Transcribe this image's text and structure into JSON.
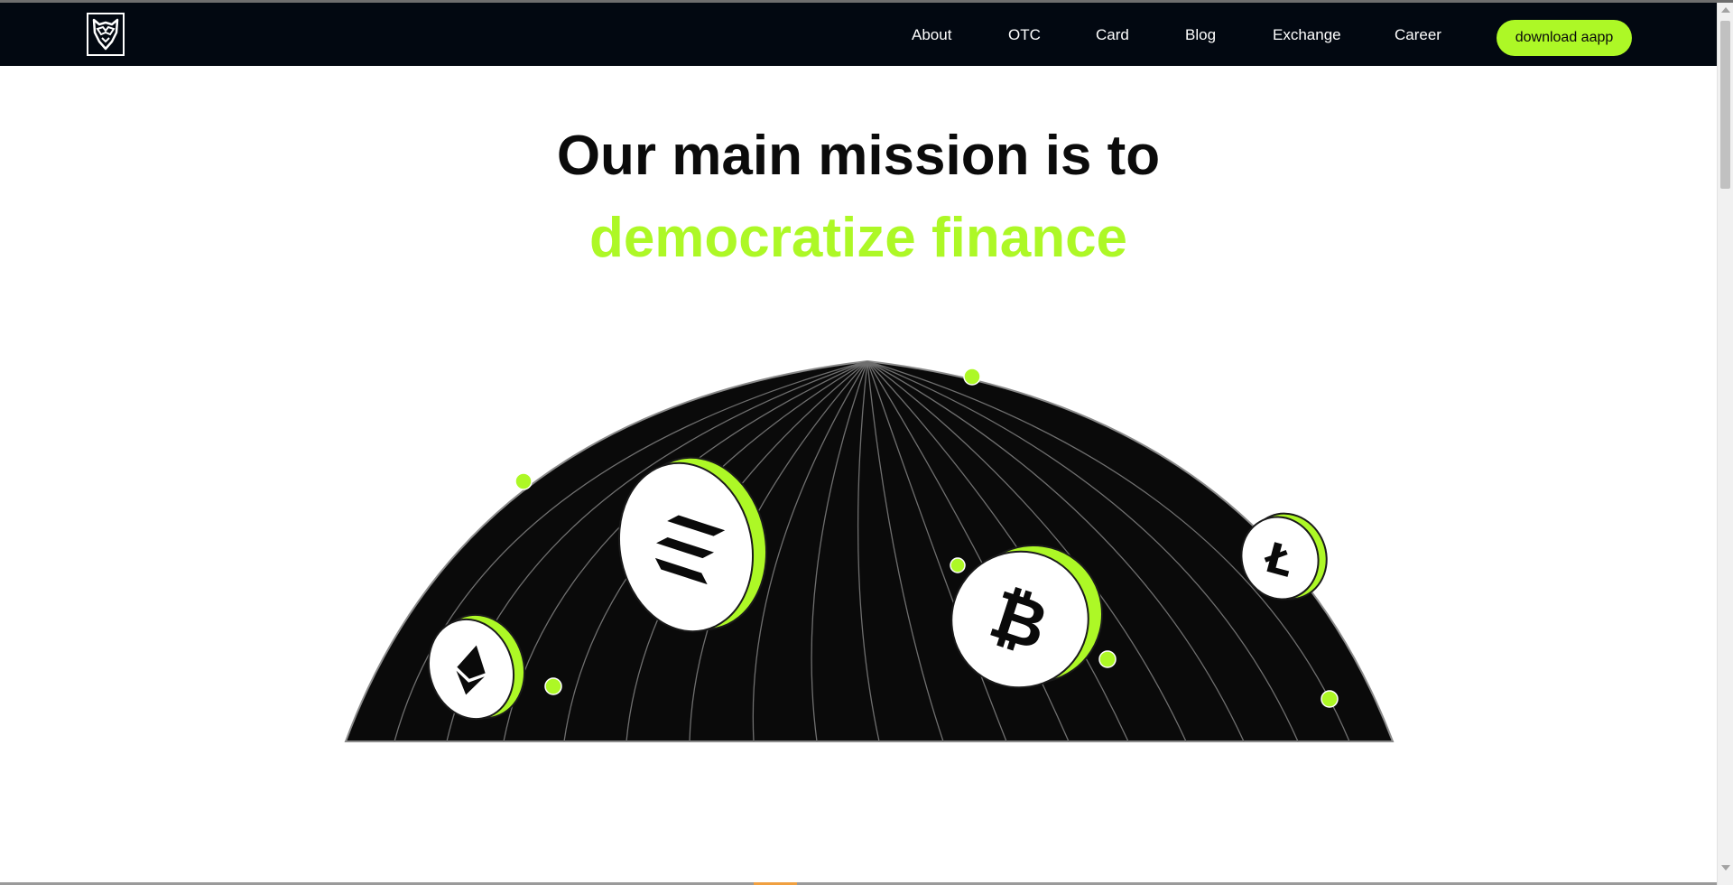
{
  "header": {
    "logo_icon": "owl-shield-logo-icon",
    "nav": {
      "about": "About",
      "otc": "OTC",
      "card": "Card",
      "blog": "Blog",
      "exchange": "Exchange",
      "career": "Career"
    },
    "cta_label": "download aapp"
  },
  "hero": {
    "headline": "Our main mission is to",
    "headline_accent": "democratize finance"
  },
  "illustration": {
    "name": "globe-illustration",
    "coins": [
      "solana-icon",
      "bitcoin-icon",
      "ethereum-icon",
      "litecoin-icon"
    ]
  },
  "colors": {
    "accent": "#adf826",
    "navbar": "#020811",
    "globe": "#0a0a0a",
    "headline": "#0b0b0b"
  }
}
